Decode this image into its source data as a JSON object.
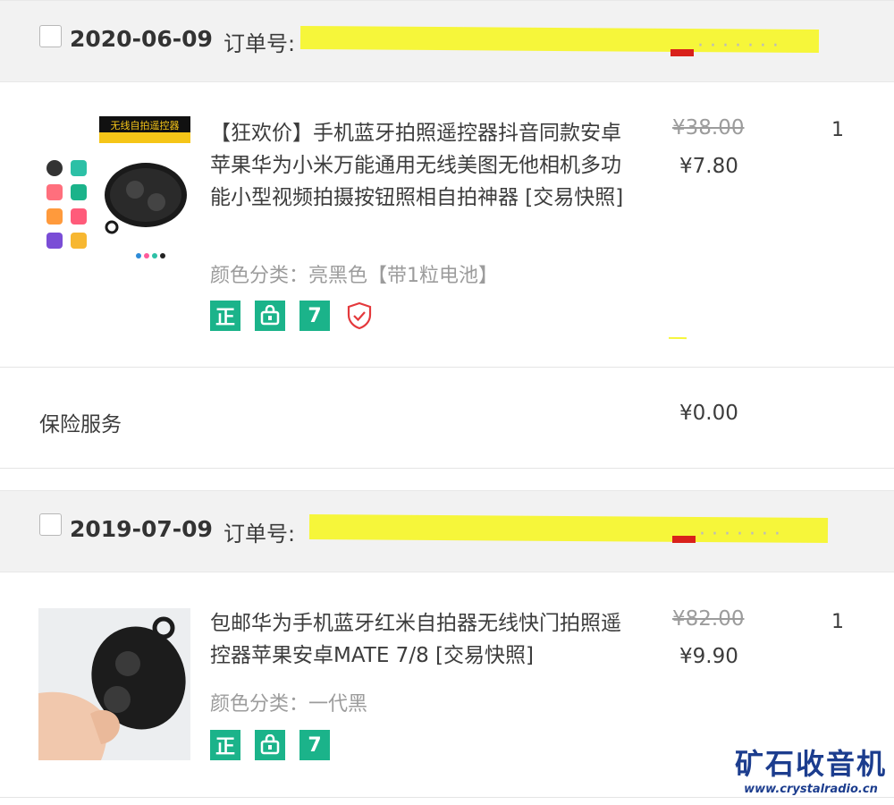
{
  "orders": [
    {
      "date": "2020-06-09",
      "order_no_label": "订单号:",
      "items": [
        {
          "title": "【狂欢价】手机蓝牙拍照遥控器抖音同款安卓苹果华为小米万能通用无线美图无他相机多功能小型视频拍摄按钮照相自拍神器 [交易快照]",
          "sku": "颜色分类：亮黑色【带1粒电池】",
          "original_price": "¥38.00",
          "price": "¥7.80",
          "quantity": "1",
          "thumb_caption": "无线自拍遥控器",
          "badges": [
            "正",
            "shopping-bag-icon",
            "7",
            "shield-check-icon"
          ]
        }
      ],
      "service": {
        "label": "保险服务",
        "price": "¥0.00"
      }
    },
    {
      "date": "2019-07-09",
      "order_no_label": "订单号:",
      "items": [
        {
          "title": "包邮华为手机蓝牙红米自拍器无线快门拍照遥控器苹果安卓MATE 7/8 [交易快照]",
          "sku": "颜色分类：一代黑",
          "original_price": "¥82.00",
          "price": "¥9.90",
          "quantity": "1",
          "badges": [
            "正",
            "shopping-bag-icon",
            "7"
          ]
        }
      ]
    }
  ],
  "watermark": {
    "name": "矿石收音机",
    "url": "www.crystalradio.cn"
  },
  "colors": {
    "badge_green": "#1bb38a",
    "redaction": "#f6f63a",
    "shield_red": "#e4393c",
    "header_bg": "#f2f2f2"
  }
}
